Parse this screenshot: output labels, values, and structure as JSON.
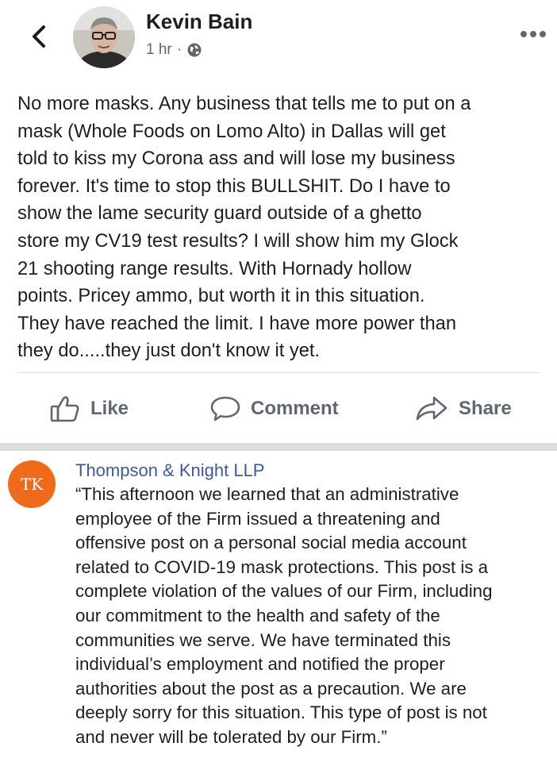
{
  "post": {
    "author_name": "Kevin Bain",
    "timestamp": "1 hr",
    "meta_separator": "·",
    "privacy_icon": "globe-icon",
    "avatar_icon": "profile-photo",
    "lines": [
      "No more masks. Any business that tells me to put on a",
      "mask (Whole Foods on Lomo Alto) in Dallas will get",
      "told to kiss my Corona ass and will lose my business",
      "forever. It's time to stop this BULLSHIT. Do I have to",
      "show the lame security guard outside of a ghetto",
      "store my CV19 test results? I will show him my Glock",
      "21 shooting range results. With Hornady hollow",
      "points. Pricey ammo, but worth it in this situation.",
      "They have reached the limit. I have more power than",
      "they do.....they just don't know it yet."
    ],
    "actions": {
      "like": "Like",
      "comment": "Comment",
      "share": "Share"
    }
  },
  "statement": {
    "org_initials": "TK",
    "org_name": "Thompson & Knight LLP",
    "lines": [
      "“This afternoon we learned that an administrative",
      "employee of the Firm issued a threatening and",
      "offensive post on a personal social media account",
      "related to COVID-19 mask protections. This post is a",
      "complete violation of the values of our Firm, including",
      "our commitment to the health and safety of the",
      "communities we serve. We have terminated this",
      "individual’s employment and notified the proper",
      "authorities about the post as a precaution. We are",
      "deeply sorry for this situation. This type of post is not",
      "and never will be tolerated by our Firm.”"
    ]
  },
  "colors": {
    "text": "#1c1e21",
    "secondary_text": "#606770",
    "org_link": "#3c5a99",
    "org_avatar": "#f06a1c",
    "separator": "#dcdcdc"
  }
}
